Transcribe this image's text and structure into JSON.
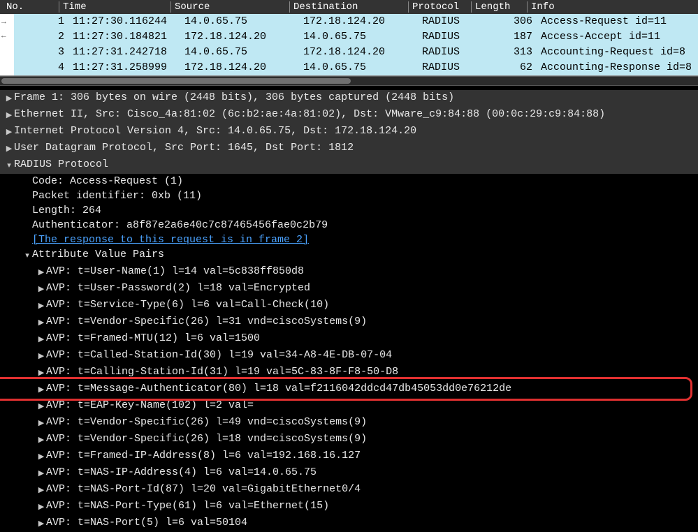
{
  "columns": [
    "No.",
    "Time",
    "Source",
    "Destination",
    "Protocol",
    "Length",
    "Info"
  ],
  "packets": [
    {
      "no": "1",
      "time": "11:27:30.116244",
      "src": "14.0.65.75",
      "dst": "172.18.124.20",
      "proto": "RADIUS",
      "len": "306",
      "info": "Access-Request id=11",
      "sel": true
    },
    {
      "no": "2",
      "time": "11:27:30.184821",
      "src": "172.18.124.20",
      "dst": "14.0.65.75",
      "proto": "RADIUS",
      "len": "187",
      "info": "Access-Accept id=11",
      "sel": true
    },
    {
      "no": "3",
      "time": "11:27:31.242718",
      "src": "14.0.65.75",
      "dst": "172.18.124.20",
      "proto": "RADIUS",
      "len": "313",
      "info": "Accounting-Request id=8",
      "sel": true
    },
    {
      "no": "4",
      "time": "11:27:31.258999",
      "src": "172.18.124.20",
      "dst": "14.0.65.75",
      "proto": "RADIUS",
      "len": "62",
      "info": "Accounting-Response id=8",
      "sel": true
    }
  ],
  "chart_data": {
    "type": "table",
    "title": "RADIUS packet capture",
    "columns": [
      "No.",
      "Time",
      "Source",
      "Destination",
      "Protocol",
      "Length",
      "Info"
    ],
    "rows": [
      [
        1,
        "11:27:30.116244",
        "14.0.65.75",
        "172.18.124.20",
        "RADIUS",
        306,
        "Access-Request id=11"
      ],
      [
        2,
        "11:27:30.184821",
        "172.18.124.20",
        "14.0.65.75",
        "RADIUS",
        187,
        "Access-Accept id=11"
      ],
      [
        3,
        "11:27:31.242718",
        "14.0.65.75",
        "172.18.124.20",
        "RADIUS",
        313,
        "Accounting-Request id=8"
      ],
      [
        4,
        "11:27:31.258999",
        "172.18.124.20",
        "14.0.65.75",
        "RADIUS",
        62,
        "Accounting-Response id=8"
      ]
    ]
  },
  "details": {
    "frame": "Frame 1: 306 bytes on wire (2448 bits), 306 bytes captured (2448 bits)",
    "eth": "Ethernet II, Src: Cisco_4a:81:02 (6c:b2:ae:4a:81:02), Dst: VMware_c9:84:88 (00:0c:29:c9:84:88)",
    "ip": "Internet Protocol Version 4, Src: 14.0.65.75, Dst: 172.18.124.20",
    "udp": "User Datagram Protocol, Src Port: 1645, Dst Port: 1812",
    "radius": "RADIUS Protocol",
    "code": "Code: Access-Request (1)",
    "pktid": "Packet identifier: 0xb (11)",
    "length": "Length: 264",
    "auth": "Authenticator: a8f87e2a6e40c7c87465456fae0c2b79",
    "link": "[The response to this request is in frame 2]",
    "avp_hdr": "Attribute Value Pairs",
    "avps": [
      "AVP: t=User-Name(1) l=14 val=5c838ff850d8",
      "AVP: t=User-Password(2) l=18 val=Encrypted",
      "AVP: t=Service-Type(6) l=6 val=Call-Check(10)",
      "AVP: t=Vendor-Specific(26) l=31 vnd=ciscoSystems(9)",
      "AVP: t=Framed-MTU(12) l=6 val=1500",
      "AVP: t=Called-Station-Id(30) l=19 val=34-A8-4E-DB-07-04",
      "AVP: t=Calling-Station-Id(31) l=19 val=5C-83-8F-F8-50-D8",
      "AVP: t=Message-Authenticator(80) l=18 val=f2116042ddcd47db45053dd0e76212de",
      "AVP: t=EAP-Key-Name(102) l=2 val=",
      "AVP: t=Vendor-Specific(26) l=49 vnd=ciscoSystems(9)",
      "AVP: t=Vendor-Specific(26) l=18 vnd=ciscoSystems(9)",
      "AVP: t=Framed-IP-Address(8) l=6 val=192.168.16.127",
      "AVP: t=NAS-IP-Address(4) l=6 val=14.0.65.75",
      "AVP: t=NAS-Port-Id(87) l=20 val=GigabitEthernet0/4",
      "AVP: t=NAS-Port-Type(61) l=6 val=Ethernet(15)",
      "AVP: t=NAS-Port(5) l=6 val=50104"
    ]
  },
  "highlight_avp_index": 7
}
